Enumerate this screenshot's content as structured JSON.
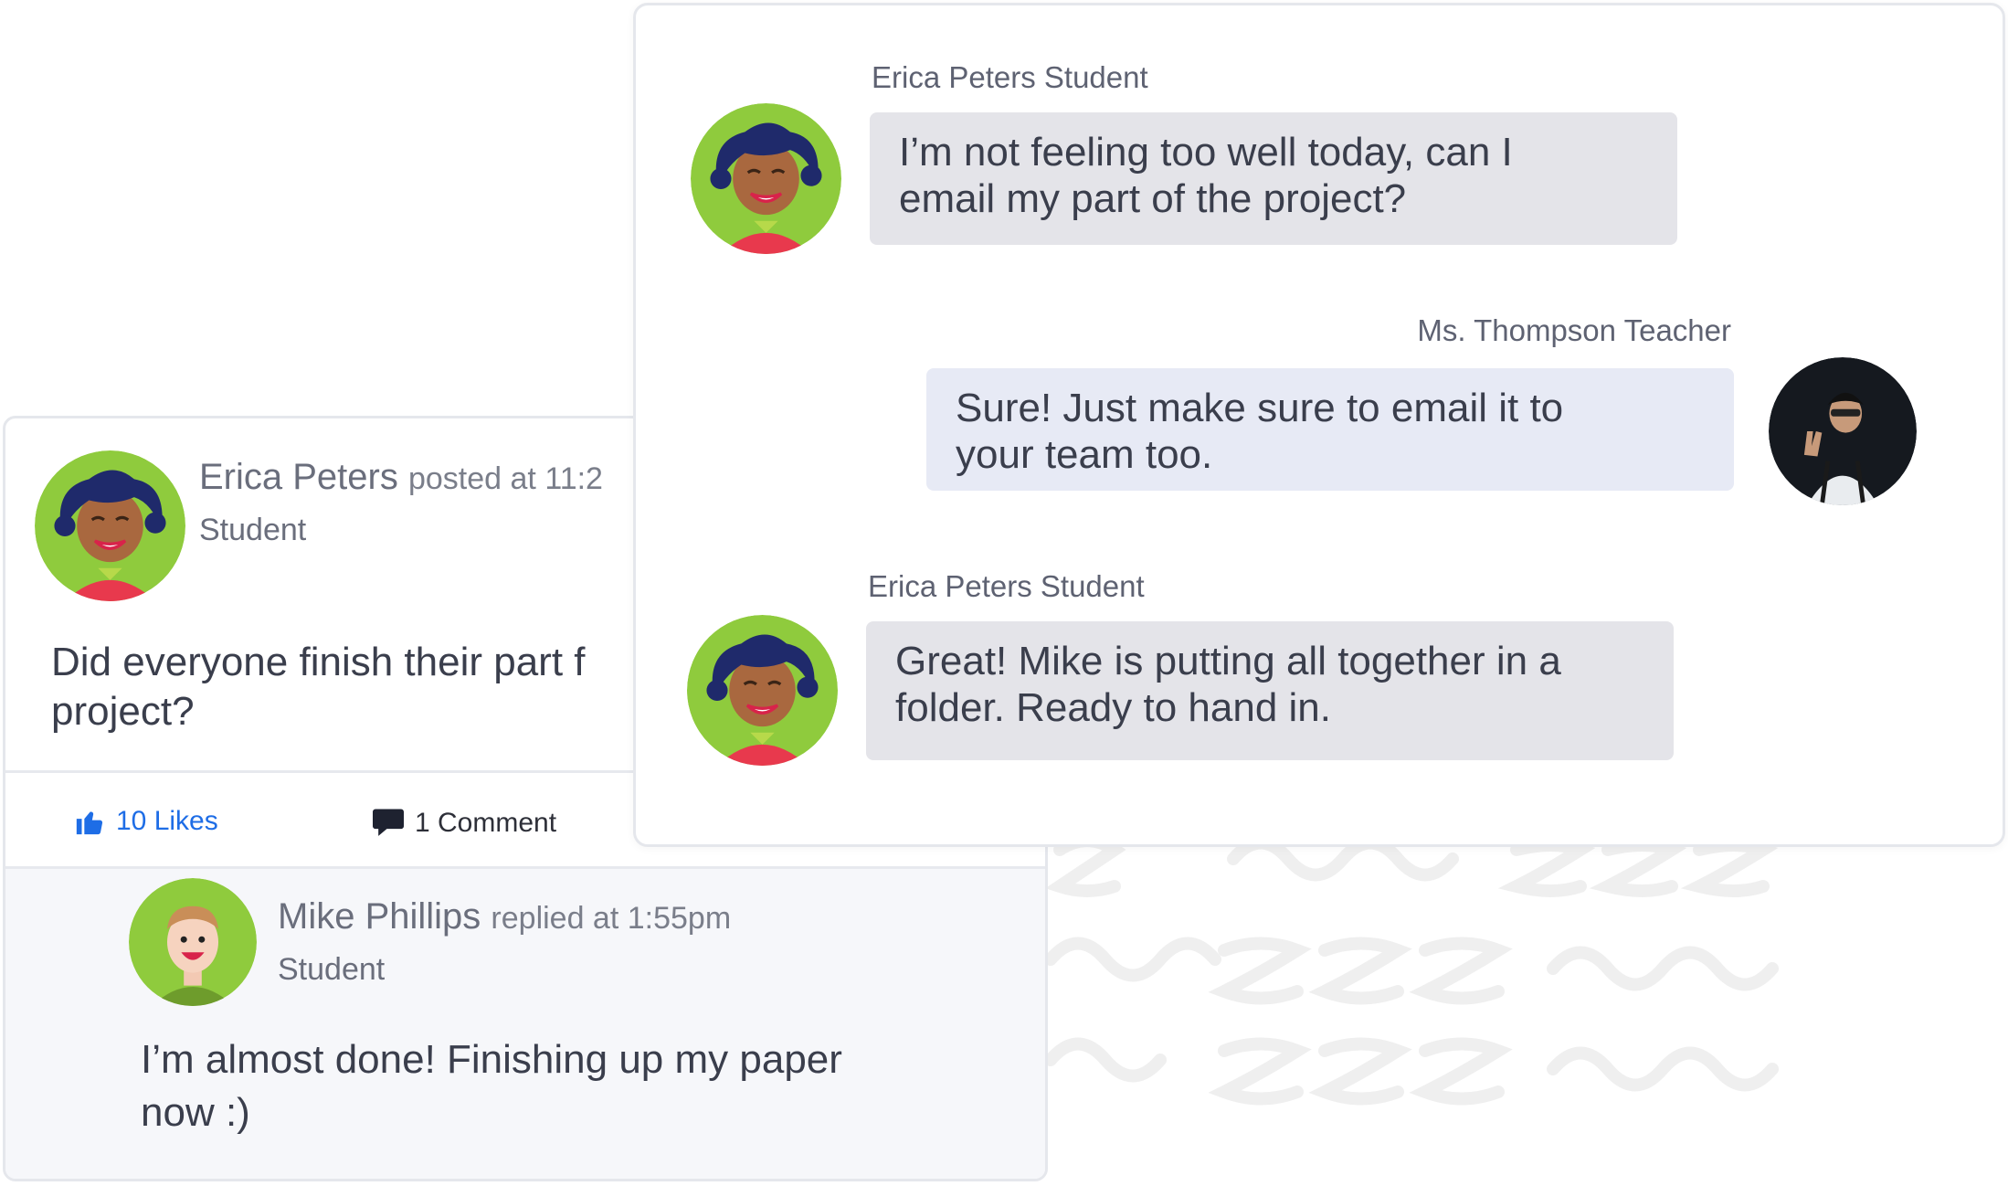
{
  "post": {
    "author": "Erica Peters",
    "timestamp": "posted at 11:2",
    "role": "Student",
    "body": "Did everyone finish their part f\nproject?",
    "likes_label": "10 Likes",
    "comments_label": "1 Comment",
    "reply": {
      "author": "Mike Phillips",
      "timestamp": "replied at 1:55pm",
      "role": "Student",
      "body": "I’m almost done! Finishing up my paper\nnow :)"
    }
  },
  "chat": {
    "messages": [
      {
        "sender": "Erica Peters Student",
        "text": "I’m not feeling too well today, can I\nemail my part of the project?"
      },
      {
        "sender": "Ms. Thompson Teacher",
        "text": "Sure! Just make sure to email it to\nyour team too."
      },
      {
        "sender": "Erica Peters Student",
        "text": "Great! Mike is putting all together in a\nfolder. Ready to hand in."
      }
    ]
  },
  "icons": {
    "like": "thumbs-up-icon",
    "comment": "speech-bubble-icon"
  },
  "colors": {
    "accent_blue": "#1e6de6",
    "student_bubble": "#e4e4e9",
    "teacher_bubble": "#e7eaf5",
    "avatar_green": "#8fcb3d"
  }
}
